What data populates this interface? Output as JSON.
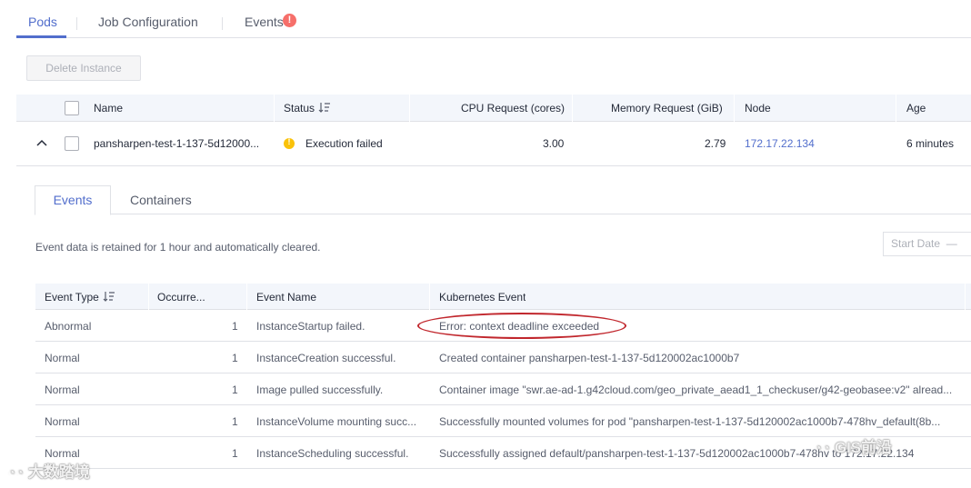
{
  "tabs": [
    {
      "label": "Pods"
    },
    {
      "label": "Job Configuration"
    },
    {
      "label": "Events",
      "badge": "!"
    }
  ],
  "actions": {
    "delete_label": "Delete Instance"
  },
  "pods_table": {
    "columns": [
      "Name",
      "Status",
      "CPU Request (cores)",
      "Memory Request (GiB)",
      "Node",
      "Age"
    ],
    "rows": [
      {
        "name": "pansharpen-test-1-137-5d12000...",
        "status": "Execution failed",
        "cpu": "3.00",
        "memory": "2.79",
        "node": "172.17.22.134",
        "age": "6 minutes"
      }
    ]
  },
  "sub_tabs": [
    {
      "label": "Events"
    },
    {
      "label": "Containers"
    }
  ],
  "events_info": "Event data is retained for 1 hour and automatically cleared.",
  "date_filter": {
    "placeholder": "Start Date",
    "separator": "—"
  },
  "events_table": {
    "columns": [
      "Event Type",
      "Occurre...",
      "Event Name",
      "Kubernetes Event"
    ],
    "rows": [
      {
        "type": "Abnormal",
        "count": "1",
        "name": "InstanceStartup failed.",
        "event": "Error: context deadline exceeded"
      },
      {
        "type": "Normal",
        "count": "1",
        "name": "InstanceCreation successful.",
        "event": "Created container pansharpen-test-1-137-5d120002ac1000b7"
      },
      {
        "type": "Normal",
        "count": "1",
        "name": "Image pulled successfully.",
        "event": "Container image \"swr.ae-ad-1.g42cloud.com/geo_private_aead1_1_checkuser/g42-geobasee:v2\" alread..."
      },
      {
        "type": "Normal",
        "count": "1",
        "name": "InstanceVolume mounting succ...",
        "event": "Successfully mounted volumes for pod \"pansharpen-test-1-137-5d120002ac1000b7-478hv_default(8b..."
      },
      {
        "type": "Normal",
        "count": "1",
        "name": "InstanceScheduling successful.",
        "event": "Successfully assigned default/pansharpen-test-1-137-5d120002ac1000b7-478hv to 172.17.22.134"
      }
    ]
  },
  "watermarks": {
    "left": "大数踏境",
    "right": "GIS前沿"
  },
  "colors": {
    "accent": "#526ecc",
    "warning": "#fac20a",
    "error_badge": "#f66f6a",
    "annotation": "#c1272d"
  }
}
